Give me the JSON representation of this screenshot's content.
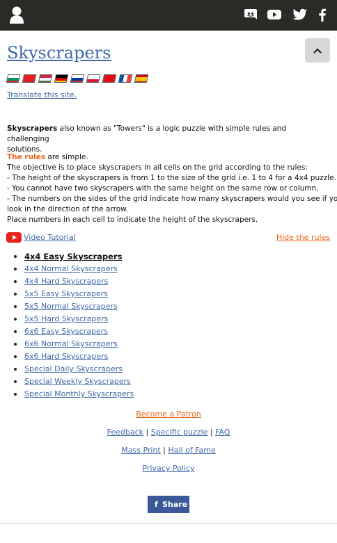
{
  "header": {
    "icons": [
      "user-icon",
      "discord-icon",
      "youtube-icon",
      "twitter-icon",
      "facebook-icon"
    ]
  },
  "title": "Skyscrapers",
  "flags": [
    "bulgarian-flag",
    "albanian-flag",
    "hungarian-flag",
    "german-flag",
    "russian-flag",
    "polish-flag",
    "turkish-flag",
    "french-flag",
    "spanish-flag"
  ],
  "translate_link": "Translate this site.",
  "intro": {
    "bold": "Skyscrapers",
    "line1": " also known as \"Towers\" is a logic puzzle with simple rules and challenging",
    "line2": "solutions."
  },
  "rules": {
    "heading": "The rules",
    "heading_rest": " are simple.",
    "lines": [
      "The objective is to place skyscrapers in all cells on the grid according to the rules:",
      "- The height of the skyscrapers is from 1 to the size of the grid i.e. 1 to 4 for a 4x4 puzzle.",
      "- You cannot have two skyscrapers with the same height on the same row or column.",
      "- The numbers on the sides of the grid indicate how many skyscrapers would you see if you",
      "look in the direction of the arrow.",
      "Place numbers in each cell to indicate the height of the skyscrapers."
    ]
  },
  "video_tutorial": "Video Tutorial",
  "hide_rules": "Hide the rules",
  "puzzles": [
    "4x4 Easy Skyscrapers",
    "4x4 Normal Skyscrapers",
    "4x4 Hard Skyscrapers",
    "5x5 Easy Skyscrapers",
    "5x5 Normal Skyscrapers",
    "5x5 Hard Skyscrapers",
    "6x6 Easy Skyscrapers",
    "6x6 Normal Skyscrapers",
    "6x6 Hard Skyscrapers",
    "Special Daily Skyscrapers",
    "Special Weekly Skyscrapers",
    "Special Monthly Skyscrapers"
  ],
  "footer": {
    "patron": "Become a Patron",
    "feedback": "Feedback",
    "specific_puzzle": "Specific puzzle",
    "faq": "FAQ",
    "mass_print": "Mass Print",
    "hall_of_fame": "Hall of Fame",
    "privacy": "Privacy Policy",
    "separator": "|",
    "share": "Share",
    "share_icon": "f"
  },
  "colors": {
    "header_bg": "#2b2a26",
    "link": "#3f68a8",
    "accent_orange": "#e8641b",
    "facebook_blue": "#3b5998"
  }
}
